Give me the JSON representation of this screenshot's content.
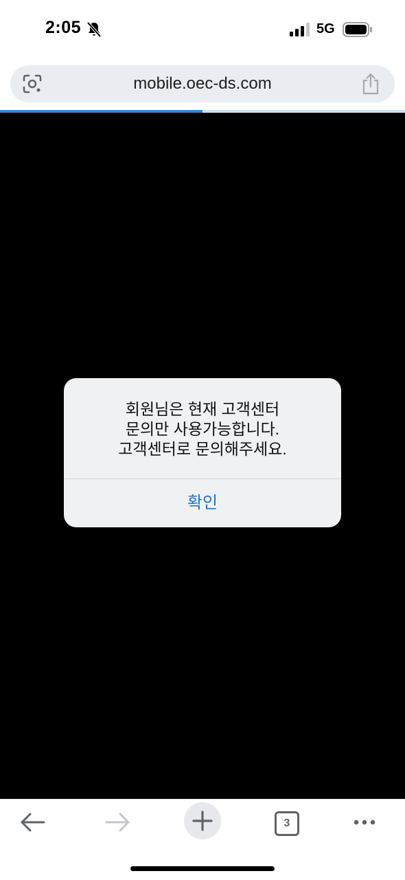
{
  "status_bar": {
    "time": "2:05",
    "network": "5G"
  },
  "address_bar": {
    "url": "mobile.oec-ds.com"
  },
  "progress": {
    "fraction": 0.5
  },
  "alert": {
    "message_lines": [
      "회원님은 현재 고객센터",
      "문의만 사용가능합니다.",
      "고객센터로 문의해주세요."
    ],
    "confirm_label": "확인"
  },
  "toolbar": {
    "tab_count": "3"
  },
  "colors": {
    "accent": "#1a76d2",
    "progress": "#2d86e3",
    "content_background": "#000000",
    "alert_background": "#eff1f3"
  },
  "icons": [
    "bell-slash-icon",
    "signal-icon",
    "battery-icon",
    "lens-icon",
    "share-icon",
    "back-arrow-icon",
    "forward-arrow-icon",
    "plus-icon",
    "tab-switcher-icon",
    "more-icon"
  ]
}
